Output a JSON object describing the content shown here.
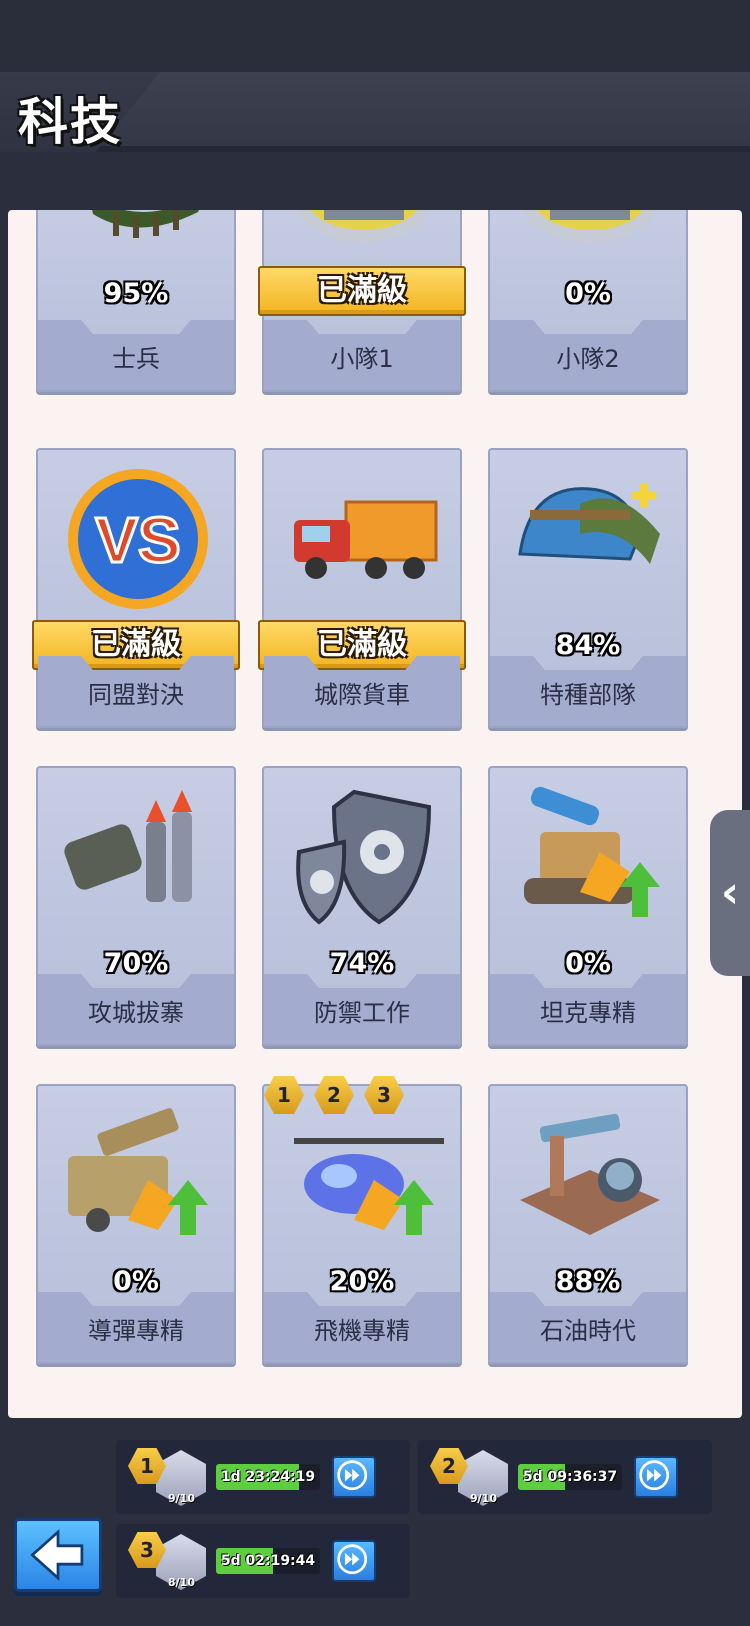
{
  "header": {
    "title": "科技"
  },
  "cards": [
    {
      "id": "soldier",
      "name": "士兵",
      "percent": "95%",
      "maxed": false,
      "icon": "soldier-unit-icon"
    },
    {
      "id": "squad1",
      "name": "小隊1",
      "percent": "",
      "maxed": true,
      "icon": "tank-unit-icon"
    },
    {
      "id": "squad2",
      "name": "小隊2",
      "percent": "0%",
      "maxed": false,
      "icon": "tank-unit-icon"
    },
    {
      "id": "alliance",
      "name": "同盟對決",
      "percent": "",
      "maxed": true,
      "icon": "vs-icon"
    },
    {
      "id": "truck",
      "name": "城際貨車",
      "percent": "",
      "maxed": true,
      "icon": "cargo-truck-icon"
    },
    {
      "id": "special",
      "name": "特種部隊",
      "percent": "84%",
      "maxed": false,
      "icon": "helmet-icon"
    },
    {
      "id": "siege",
      "name": "攻城拔寨",
      "percent": "70%",
      "maxed": false,
      "icon": "missiles-icon"
    },
    {
      "id": "defense",
      "name": "防禦工作",
      "percent": "74%",
      "maxed": false,
      "icon": "shield-gear-icon"
    },
    {
      "id": "tank",
      "name": "坦克專精",
      "percent": "0%",
      "maxed": false,
      "icon": "tank-upgrade-icon"
    },
    {
      "id": "missile",
      "name": "導彈專精",
      "percent": "0%",
      "maxed": false,
      "icon": "missile-launcher-upgrade-icon"
    },
    {
      "id": "aircraft",
      "name": "飛機專精",
      "percent": "20%",
      "maxed": false,
      "icon": "helicopter-upgrade-icon"
    },
    {
      "id": "oil",
      "name": "石油時代",
      "percent": "88%",
      "maxed": false,
      "icon": "oil-pump-icon"
    }
  ],
  "maxed_label": "已滿級",
  "aircraft_levels": [
    "1",
    "2",
    "3"
  ],
  "queue": [
    {
      "slot": "1",
      "count": "9/10",
      "timer": "1d 23:24:19",
      "progress": 0.8
    },
    {
      "slot": "2",
      "count": "9/10",
      "timer": "5d 09:36:37",
      "progress": 0.45
    },
    {
      "slot": "3",
      "count": "8/10",
      "timer": "5d 02:19:44",
      "progress": 0.55
    }
  ],
  "icons": {
    "back": "back-arrow-icon",
    "speedup": "fast-forward-icon",
    "side_tab": "chevron-left-icon"
  },
  "colors": {
    "maxed": "#f2b421",
    "timer_fill": "#5dcf3f",
    "button": "#2a7fe0"
  }
}
